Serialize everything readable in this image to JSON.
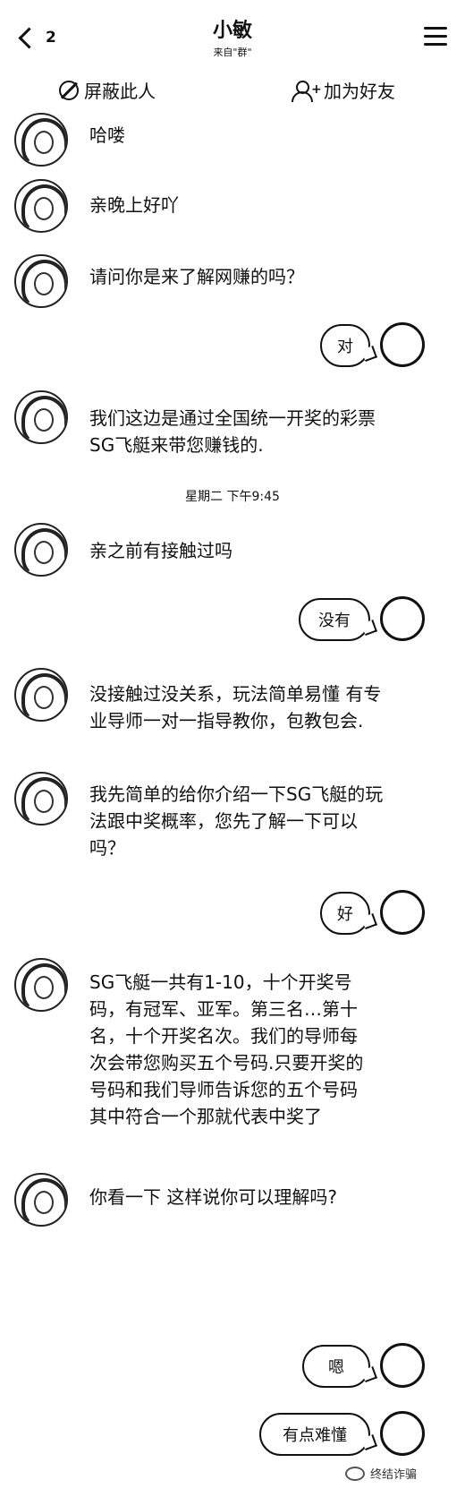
{
  "header": {
    "back_count": "2",
    "title": "小敏",
    "subtitle": "来自\"群\""
  },
  "actions": {
    "block_label": "屏蔽此人",
    "add_friend_label": "加为好友"
  },
  "messages": [
    {
      "text": "哈喽"
    },
    {
      "text": "亲晚上好吖"
    },
    {
      "text": "请问你是来了解网赚的吗？"
    },
    {
      "text": "我们这边是通过全国统一开奖的彩票SG飞艇来带您赚钱的."
    },
    {
      "text": " 亲之前有接触过吗"
    },
    {
      "text": "没接触过没关系，玩法简单易懂 有专业导师一对一指导教你，包教包会."
    },
    {
      "text": "我先简单的给你介绍一下SG飞艇的玩法跟中奖概率，您先了解一下可以吗？"
    },
    {
      "text": "SG飞艇一共有1-10，十个开奖号码，有冠军、亚军。第三名…第十名，十个开奖名次。我们的导师每次会带您购买五个号码.只要开奖的号码和我们导师告诉您的五个号码其中符合一个那就代表中奖了"
    },
    {
      "text": "你看一下  这样说你可以理解吗?"
    }
  ],
  "self_messages": [
    {
      "text": "对"
    },
    {
      "text": "没有"
    },
    {
      "text": "好"
    },
    {
      "text": "嗯"
    },
    {
      "text": "有点难懂"
    }
  ],
  "timestamp": "星期二 下午9:45",
  "watermark": "终结诈骗",
  "icons": {
    "back": "chevron-left-icon",
    "menu": "menu-icon",
    "block": "ban-icon",
    "add_friend": "add-user-icon"
  }
}
